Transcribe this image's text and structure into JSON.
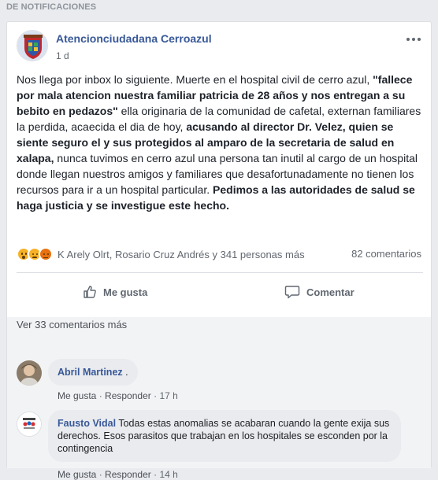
{
  "section_header": "DE NOTIFICACIONES",
  "post": {
    "author": "Atencionciudadana Cerroazul",
    "time": "1 d",
    "text_segments": [
      " Nos llega por inbox lo siguiente.  Muerte en el hospital civil de cerro azul, ",
      "\"fallece por mala atencion nuestra familiar patricia de 28 años y nos entregan a su bebito en pedazos\"",
      "  ella originaria de la comunidad de cafetal, externan familiares la perdida, acaecida el dia de hoy, ",
      "acusando al director Dr. Velez, quien se siente seguro el y sus protegidos al amparo de la secretaria de salud en xalapa,",
      " nunca tuvimos en cerro azul una persona tan inutil al cargo de un hospital donde llegan nuestros amigos y familiares que desafortunadamente no tienen los recursos para ir a un hospital particular. ",
      "Pedimos a las autoridades de salud se haga justicia y se investigue este hecho."
    ],
    "reactions": [
      "wow",
      "sad",
      "angry"
    ],
    "reaction_names": "K Arely Olrt, Rosario Cruz Andrés y 341 personas más",
    "comments_count": "82 comentarios",
    "like_label": "Me gusta",
    "comment_label": "Comentar"
  },
  "comments_section": {
    "more_comments": "Ver 33 comentarios más",
    "comments": [
      {
        "author": "Abril Martinez",
        "text": " .",
        "like": "Me gusta",
        "reply": "Responder",
        "sep": "·",
        "time": "17 h"
      },
      {
        "author": "Fausto Vidal",
        "text": " Todas estas anomalias se acabaran cuando la gente exija sus derechos. Esos parasitos que trabajan en los hospitales se esconden por la contingencia",
        "like": "Me gusta",
        "reply": "Responder",
        "sep": "·",
        "time": "14 h"
      }
    ]
  },
  "colors": {
    "link_blue": "#385898",
    "meta_gray": "#616770",
    "background": "#e9ebee"
  }
}
